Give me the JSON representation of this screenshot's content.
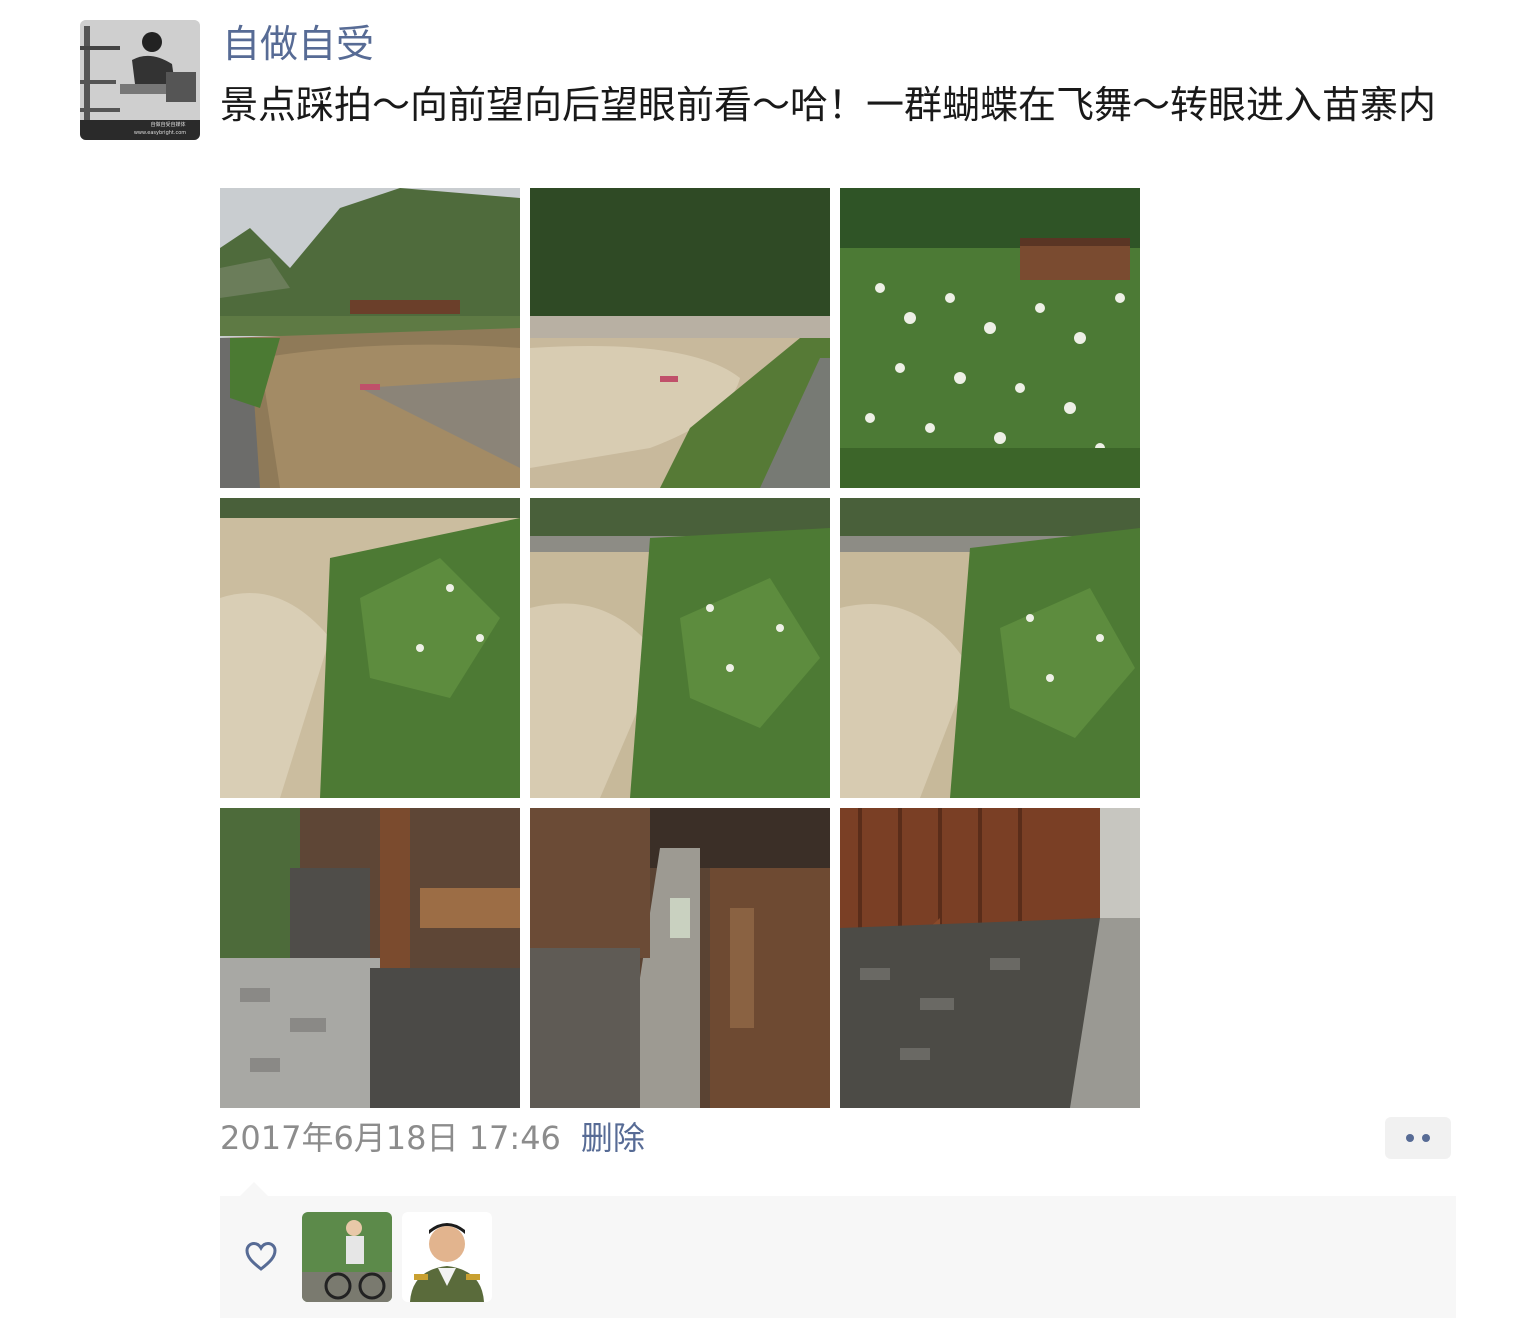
{
  "post": {
    "author_name": "自做自受",
    "avatar_caption": "自做自受自媒体",
    "avatar_url_text": "www.easybright.com",
    "text": "景点踩拍～向前望向后望眼前看～哈！一群蝴蝶在飞舞～转眼进入苗寨内",
    "timestamp": "2017年6月18日 17:46",
    "delete_label": "删除"
  },
  "likes": {
    "icon": "heart-outline-icon",
    "count_shown": 2
  },
  "colors": {
    "link_blue": "#576b95",
    "timestamp_gray": "#8c8c8c",
    "likes_bg": "#f7f7f7"
  }
}
